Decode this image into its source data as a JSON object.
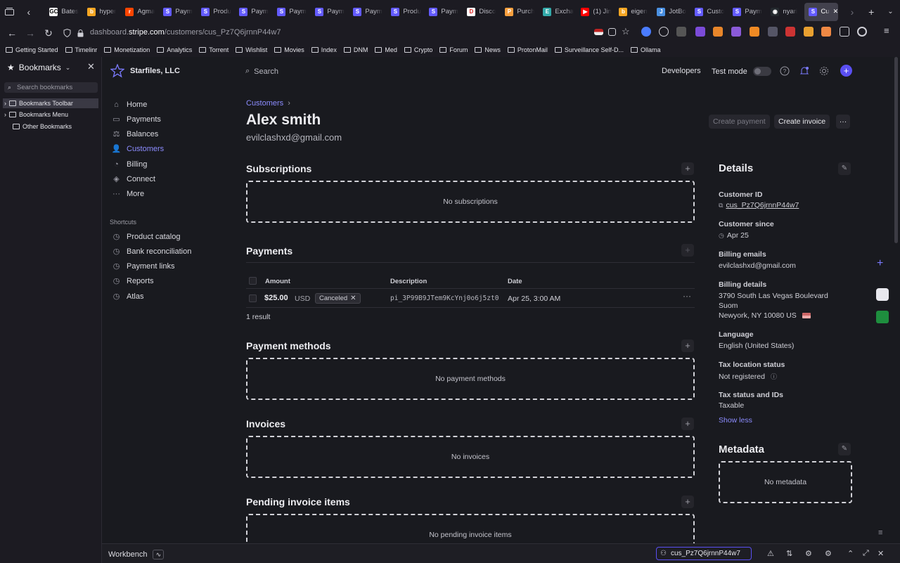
{
  "tabs": [
    {
      "label": "Bates",
      "fav": "GC",
      "color": "#ffffff",
      "fg": "#000000"
    },
    {
      "label": "hyper",
      "fav": "b",
      "color": "#f5a623",
      "fg": "#ffffff"
    },
    {
      "label": "Agma",
      "fav": "r",
      "color": "#ff4500",
      "fg": "#ffffff"
    },
    {
      "label": "Paym",
      "fav": "S",
      "color": "#635bff",
      "fg": "#ffffff"
    },
    {
      "label": "Produ",
      "fav": "S",
      "color": "#635bff",
      "fg": "#ffffff"
    },
    {
      "label": "Paym",
      "fav": "S",
      "color": "#635bff",
      "fg": "#ffffff"
    },
    {
      "label": "Paym",
      "fav": "S",
      "color": "#635bff",
      "fg": "#ffffff"
    },
    {
      "label": "Paym",
      "fav": "S",
      "color": "#635bff",
      "fg": "#ffffff"
    },
    {
      "label": "Paym",
      "fav": "S",
      "color": "#635bff",
      "fg": "#ffffff"
    },
    {
      "label": "Produ",
      "fav": "S",
      "color": "#635bff",
      "fg": "#ffffff"
    },
    {
      "label": "Paym",
      "fav": "S",
      "color": "#635bff",
      "fg": "#ffffff"
    },
    {
      "label": "Disco",
      "fav": "D",
      "color": "#ffffff",
      "fg": "#d22"
    },
    {
      "label": "Purch",
      "fav": "P",
      "color": "#f9a03f",
      "fg": "#ffffff"
    },
    {
      "label": "Excha",
      "fav": "E",
      "color": "#3aa",
      "fg": "#ffffff"
    },
    {
      "label": "(1) Jin",
      "fav": "▶",
      "color": "#ff0000",
      "fg": "#ffffff"
    },
    {
      "label": "eigen",
      "fav": "b",
      "color": "#f5a623",
      "fg": "#ffffff"
    },
    {
      "label": "JotBo",
      "fav": "J",
      "color": "#4a90e2",
      "fg": "#ffffff"
    },
    {
      "label": "Custo",
      "fav": "S",
      "color": "#635bff",
      "fg": "#ffffff"
    },
    {
      "label": "Paym",
      "fav": "S",
      "color": "#635bff",
      "fg": "#ffffff"
    },
    {
      "label": "nyari",
      "fav": "◉",
      "color": "#24292e",
      "fg": "#ffffff"
    },
    {
      "label": "Cu",
      "fav": "S",
      "color": "#635bff",
      "fg": "#ffffff",
      "active": true
    }
  ],
  "url": {
    "prefix": "dashboard.",
    "domain": "stripe.com",
    "path": "/customers/cus_Pz7Q6jrnnP44w7"
  },
  "bookmarks_bar": [
    "Getting Started",
    "Timelinr",
    "Monetization",
    "Analytics",
    "Torrent",
    "Wishlist",
    "Movies",
    "Index",
    "DNM",
    "Med",
    "Crypto",
    "Forum",
    "News",
    "ProtonMail",
    "Surveillance Self-D...",
    "Ollama"
  ],
  "bookmark_panel": {
    "title": "Bookmarks",
    "search_placeholder": "Search bookmarks",
    "items": [
      "Bookmarks Toolbar",
      "Bookmarks Menu",
      "Other Bookmarks"
    ]
  },
  "stripe": {
    "account": "Starfiles, LLC",
    "search": "Search",
    "developers": "Developers",
    "test_mode": "Test mode",
    "nav": [
      {
        "label": "Home",
        "icon": "home-icon"
      },
      {
        "label": "Payments",
        "icon": "payments-icon"
      },
      {
        "label": "Balances",
        "icon": "balances-icon"
      },
      {
        "label": "Customers",
        "icon": "customers-icon",
        "active": true
      },
      {
        "label": "Billing",
        "icon": "billing-icon"
      },
      {
        "label": "Connect",
        "icon": "connect-icon"
      },
      {
        "label": "More",
        "icon": "more-icon"
      }
    ],
    "shortcuts_heading": "Shortcuts",
    "shortcuts": [
      "Product catalog",
      "Bank reconciliation",
      "Payment links",
      "Reports",
      "Atlas"
    ]
  },
  "customer": {
    "breadcrumb": "Customers",
    "name": "Alex smith",
    "email": "evilclashxd@gmail.com",
    "create_payment": "Create payment",
    "create_invoice": "Create invoice",
    "more": "···"
  },
  "sections": {
    "subscriptions": {
      "title": "Subscriptions",
      "empty": "No subscriptions"
    },
    "payments": {
      "title": "Payments",
      "columns": [
        "Amount",
        "Description",
        "Date"
      ],
      "rows": [
        {
          "amount": "$25.00",
          "currency": "USD",
          "status": "Canceled",
          "description": "pi_3P99B9JTem9KcYnj0o6j5zt0",
          "date": "Apr 25, 3:00 AM"
        }
      ],
      "result_count": "1 result"
    },
    "payment_methods": {
      "title": "Payment methods",
      "empty": "No payment methods"
    },
    "invoices": {
      "title": "Invoices",
      "empty": "No invoices"
    },
    "pending": {
      "title": "Pending invoice items",
      "empty": "No pending invoice items"
    }
  },
  "details": {
    "title": "Details",
    "customer_id_label": "Customer ID",
    "customer_id": "cus_Pz7Q6jrnnP44w7",
    "since_label": "Customer since",
    "since": "Apr 25",
    "billing_emails_label": "Billing emails",
    "billing_email": "evilclashxd@gmail.com",
    "billing_details_label": "Billing details",
    "address_line1": "3790 South Las Vegas Boulevard",
    "address_line2": "Suom",
    "address_line3": "Newyork, NY 10080 US",
    "language_label": "Language",
    "language": "English (United States)",
    "tax_location_label": "Tax location status",
    "tax_location": "Not registered",
    "tax_status_label": "Tax status and IDs",
    "tax_status": "Taxable",
    "show_less": "Show less",
    "metadata_title": "Metadata",
    "metadata_empty": "No metadata"
  },
  "workbench": {
    "title": "Workbench",
    "input_value": "cus_Pz7Q6jrnnP44w7"
  },
  "colors": {
    "accent": "#635bff",
    "link": "#8c8cff",
    "bg": "#191a1f"
  }
}
